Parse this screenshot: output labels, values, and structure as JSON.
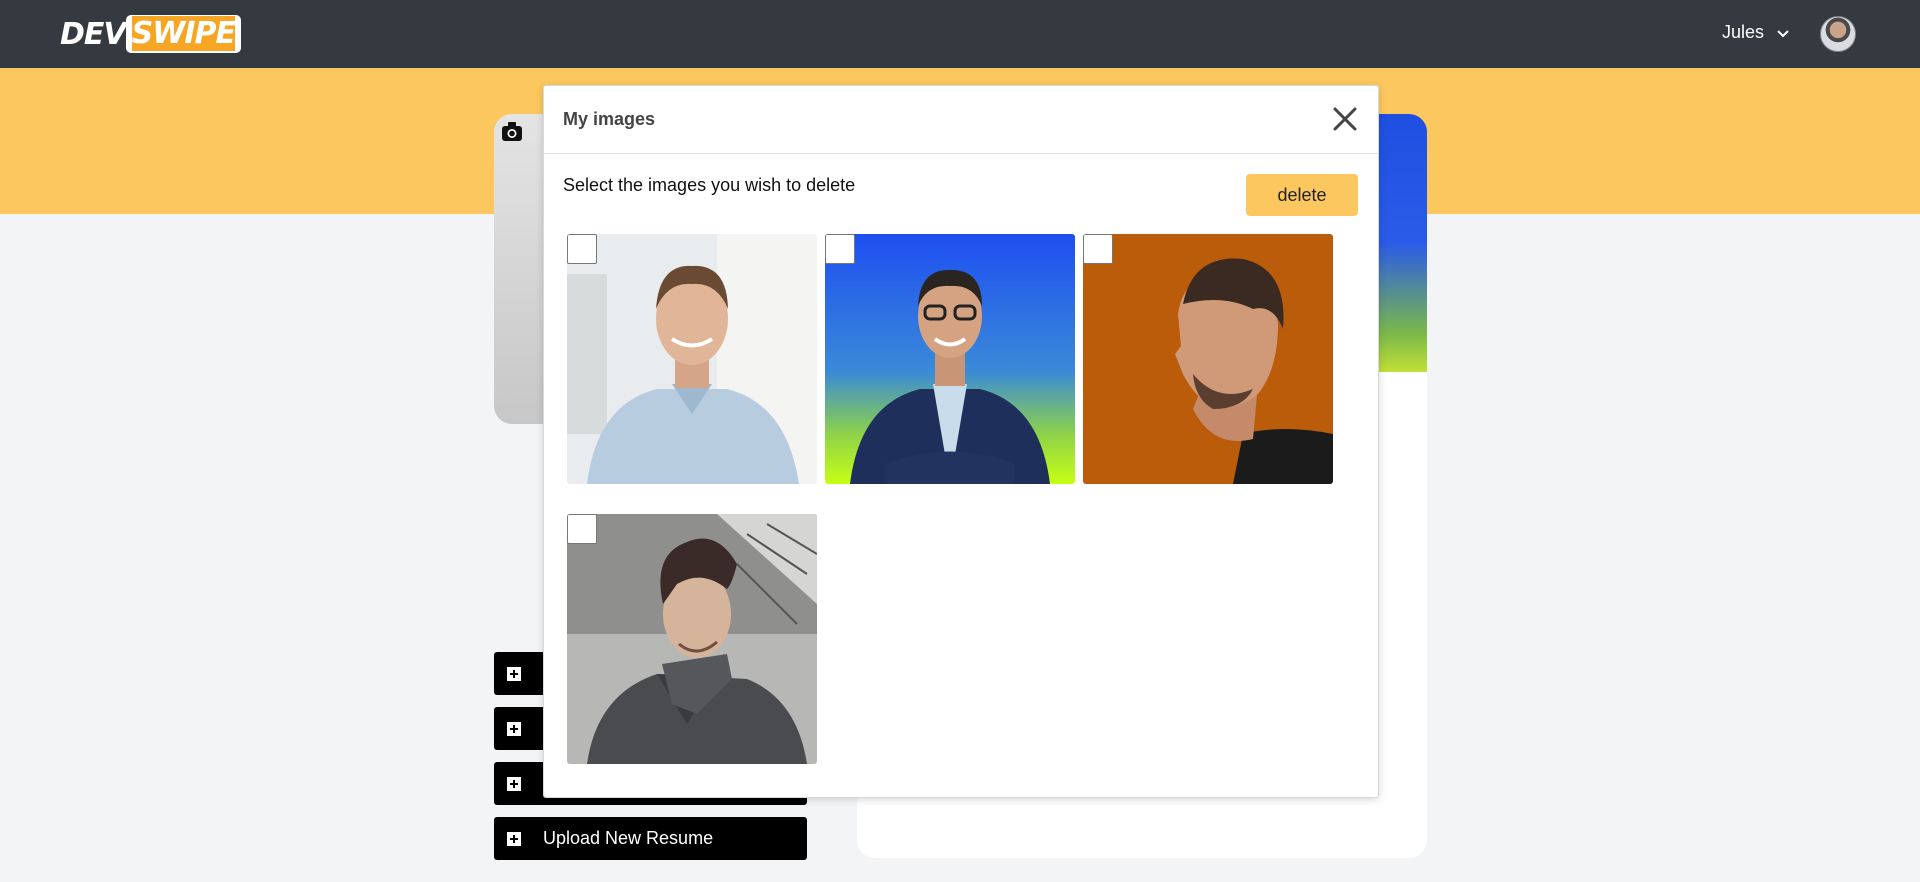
{
  "header": {
    "logo_dev": "DEV",
    "logo_swipe": "SWIPE",
    "user_name": "Jules"
  },
  "sidebar": {
    "buttons": [
      {
        "label": ""
      },
      {
        "label": ""
      },
      {
        "label": ""
      },
      {
        "label": "Upload New Resume"
      }
    ]
  },
  "modal": {
    "title": "My images",
    "instruction": "Select the images you wish to delete",
    "delete_label": "delete",
    "images": [
      {
        "checked": false,
        "alt": "man in light blue shirt in office"
      },
      {
        "checked": false,
        "alt": "man with glasses in navy blazer"
      },
      {
        "checked": false,
        "alt": "man profile on orange background"
      },
      {
        "checked": false,
        "alt": "man in grey coat outdoors"
      }
    ]
  },
  "colors": {
    "topbar": "#343a40",
    "accent": "#fcc75e",
    "page_bg": "#f3f4f6"
  }
}
